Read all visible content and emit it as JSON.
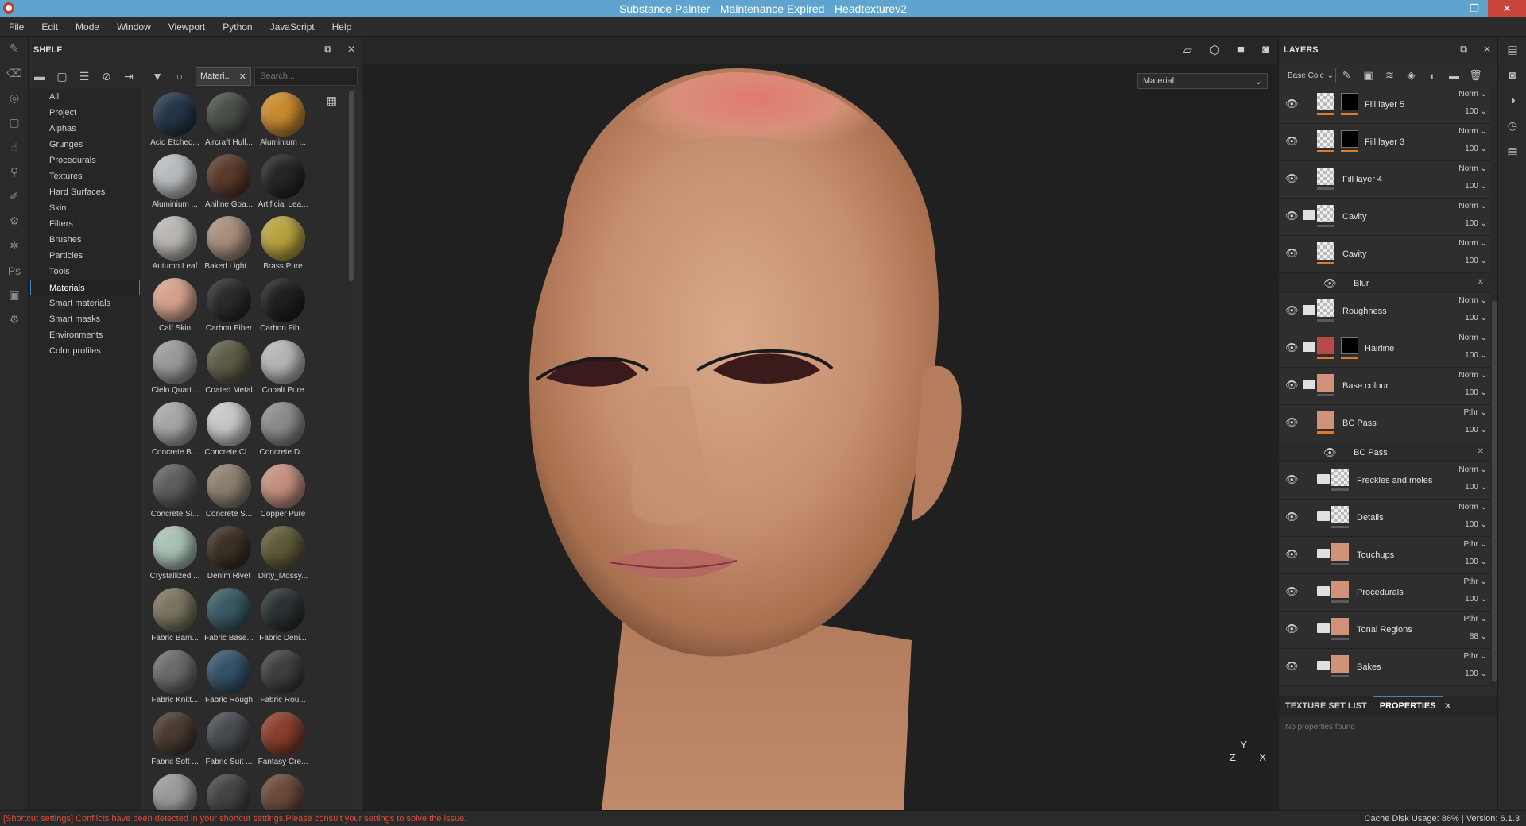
{
  "window": {
    "title": "Substance Painter - Maintenance Expired - Headtexturev2",
    "minimize": "–",
    "restore": "❐",
    "close": "✕"
  },
  "menu": [
    "File",
    "Edit",
    "Mode",
    "Window",
    "Viewport",
    "Python",
    "JavaScript",
    "Help"
  ],
  "shelf": {
    "title": "SHELF",
    "filter_chip": "Materi..",
    "search_placeholder": "Search...",
    "categories": [
      "All",
      "Project",
      "Alphas",
      "Grunges",
      "Procedurals",
      "Textures",
      "Hard Surfaces",
      "Skin",
      "Filters",
      "Brushes",
      "Particles",
      "Tools",
      "Materials",
      "Smart materials",
      "Smart masks",
      "Environments",
      "Color profiles"
    ],
    "active_category": "Materials",
    "materials": [
      {
        "label": "Acid Etched...",
        "color": "#26364a"
      },
      {
        "label": "Aircraft Hull...",
        "color": "#4a4f48"
      },
      {
        "label": "Aluminium ...",
        "color": "#c98a2e"
      },
      {
        "label": "Aluminium ...",
        "color": "#b9bcbf"
      },
      {
        "label": "Aniline Goa...",
        "color": "#5a3a2b"
      },
      {
        "label": "Artificial Lea...",
        "color": "#262626"
      },
      {
        "label": "Autumn Leaf",
        "color": "#b9b6b2"
      },
      {
        "label": "Baked Light...",
        "color": "#a88e7c"
      },
      {
        "label": "Brass Pure",
        "color": "#b8a23f"
      },
      {
        "label": "Calf Skin",
        "color": "#d6a28e"
      },
      {
        "label": "Carbon Fiber",
        "color": "#2b2b2b"
      },
      {
        "label": "Carbon Fib...",
        "color": "#202020"
      },
      {
        "label": "Cielo Quart...",
        "color": "#9a9a9a"
      },
      {
        "label": "Coated Metal",
        "color": "#5f5c48"
      },
      {
        "label": "Cobalt Pure",
        "color": "#b5b5b5"
      },
      {
        "label": "Concrete B...",
        "color": "#a7a7a7"
      },
      {
        "label": "Concrete Cl...",
        "color": "#c6c8ca"
      },
      {
        "label": "Concrete D...",
        "color": "#8c8c8c"
      },
      {
        "label": "Concrete Si...",
        "color": "#5d5f60"
      },
      {
        "label": "Concrete S...",
        "color": "#8c8170"
      },
      {
        "label": "Copper Pure",
        "color": "#c49080"
      },
      {
        "label": "Crystallized ...",
        "color": "#a9c2b3"
      },
      {
        "label": "Denim Rivet",
        "color": "#3b3026"
      },
      {
        "label": "Dirty_Mossy...",
        "color": "#5f5a3a"
      },
      {
        "label": "Fabric Bam...",
        "color": "#7a7560"
      },
      {
        "label": "Fabric Base...",
        "color": "#3a5a64"
      },
      {
        "label": "Fabric Deni...",
        "color": "#2b3234"
      },
      {
        "label": "Fabric Knitt...",
        "color": "#6b6b6b"
      },
      {
        "label": "Fabric Rough",
        "color": "#34536a"
      },
      {
        "label": "Fabric Rou...",
        "color": "#3f3f3f"
      },
      {
        "label": "Fabric Soft ...",
        "color": "#4a3a30"
      },
      {
        "label": "Fabric Suit ...",
        "color": "#484c50"
      },
      {
        "label": "Fantasy Cre...",
        "color": "#8a3e2c"
      },
      {
        "label": "",
        "color": "#9a9a9a"
      },
      {
        "label": "",
        "color": "#444444"
      },
      {
        "label": "",
        "color": "#6a4a3a"
      }
    ]
  },
  "viewport": {
    "channel_select": "Material",
    "axis": {
      "y": "Y",
      "z": "Z",
      "x": "X"
    },
    "icons": [
      "viewport-layout-icon",
      "cube-view-icon",
      "camera-icon",
      "screenshot-icon"
    ]
  },
  "layers": {
    "title": "LAYERS",
    "channel": "Base Colc",
    "items": [
      {
        "name": "Fill layer 5",
        "blend": "Norm",
        "opacity": "100",
        "folder": false,
        "thumb": "checker",
        "mask": "black-white",
        "bar": "orange",
        "indent": 0,
        "sub": false
      },
      {
        "name": "Fill layer 3",
        "blend": "Norm",
        "opacity": "100",
        "folder": false,
        "thumb": "checker",
        "mask": "black-orange",
        "bar": "orange",
        "indent": 0,
        "sub": false
      },
      {
        "name": "Fill layer 4",
        "blend": "Norm",
        "opacity": "100",
        "folder": false,
        "thumb": "checker",
        "mask": "",
        "bar": "gray",
        "indent": 0,
        "sub": false
      },
      {
        "name": "Cavity",
        "blend": "Norm",
        "opacity": "100",
        "folder": true,
        "thumb": "checker",
        "mask": "",
        "bar": "gray",
        "indent": 0,
        "sub": false
      },
      {
        "name": "Cavity",
        "blend": "Norm",
        "opacity": "100",
        "folder": false,
        "thumb": "checker",
        "mask": "",
        "bar": "orange",
        "indent": 0,
        "sub": false
      },
      {
        "name": "Blur",
        "blend": "",
        "opacity": "",
        "folder": false,
        "thumb": "",
        "mask": "",
        "bar": "",
        "indent": 0,
        "sub": true
      },
      {
        "name": "Roughness",
        "blend": "Norm",
        "opacity": "100",
        "folder": true,
        "thumb": "checker",
        "mask": "",
        "bar": "gray",
        "indent": 0,
        "sub": false
      },
      {
        "name": "Hairline",
        "blend": "Norm",
        "opacity": "100",
        "folder": true,
        "thumb": "red",
        "mask": "black-white",
        "bar": "orange",
        "indent": 0,
        "sub": false
      },
      {
        "name": "Base colour",
        "blend": "Norm",
        "opacity": "100",
        "folder": true,
        "thumb": "skin",
        "mask": "",
        "bar": "gray",
        "indent": 0,
        "sub": false
      },
      {
        "name": "BC Pass",
        "blend": "Pthr",
        "opacity": "100",
        "folder": false,
        "thumb": "skin",
        "mask": "",
        "bar": "orange",
        "indent": 0,
        "sub": false
      },
      {
        "name": "BC Pass",
        "blend": "",
        "opacity": "",
        "folder": false,
        "thumb": "",
        "mask": "",
        "bar": "",
        "indent": 0,
        "sub": true
      },
      {
        "name": "Freckles and moles",
        "blend": "Norm",
        "opacity": "100",
        "folder": true,
        "thumb": "checker",
        "mask": "",
        "bar": "gray",
        "indent": 1,
        "sub": false
      },
      {
        "name": "Details",
        "blend": "Norm",
        "opacity": "100",
        "folder": true,
        "thumb": "checker",
        "mask": "",
        "bar": "gray",
        "indent": 1,
        "sub": false
      },
      {
        "name": "Touchups",
        "blend": "Pthr",
        "opacity": "100",
        "folder": true,
        "thumb": "skin",
        "mask": "",
        "bar": "gray",
        "indent": 1,
        "sub": false
      },
      {
        "name": "Procedurals",
        "blend": "Pthr",
        "opacity": "100",
        "folder": true,
        "thumb": "skin",
        "mask": "",
        "bar": "gray",
        "indent": 1,
        "sub": false
      },
      {
        "name": "Tonal Regions",
        "blend": "Pthr",
        "opacity": "88",
        "folder": true,
        "thumb": "skin",
        "mask": "",
        "bar": "gray",
        "indent": 1,
        "sub": false
      },
      {
        "name": "Bakes",
        "blend": "Pthr",
        "opacity": "100",
        "folder": true,
        "thumb": "skin",
        "mask": "",
        "bar": "gray",
        "indent": 1,
        "sub": false
      }
    ]
  },
  "properties": {
    "tab_texture_set": "TEXTURE SET LIST",
    "tab_properties": "PROPERTIES",
    "empty_text": "No properties found"
  },
  "status": {
    "warning": "[Shortcut settings] Conflicts have been detected in your shortcut settings.Please consult your settings to solve the issue.",
    "cache": "Cache Disk Usage:   86% | Version: 6.1.3"
  }
}
